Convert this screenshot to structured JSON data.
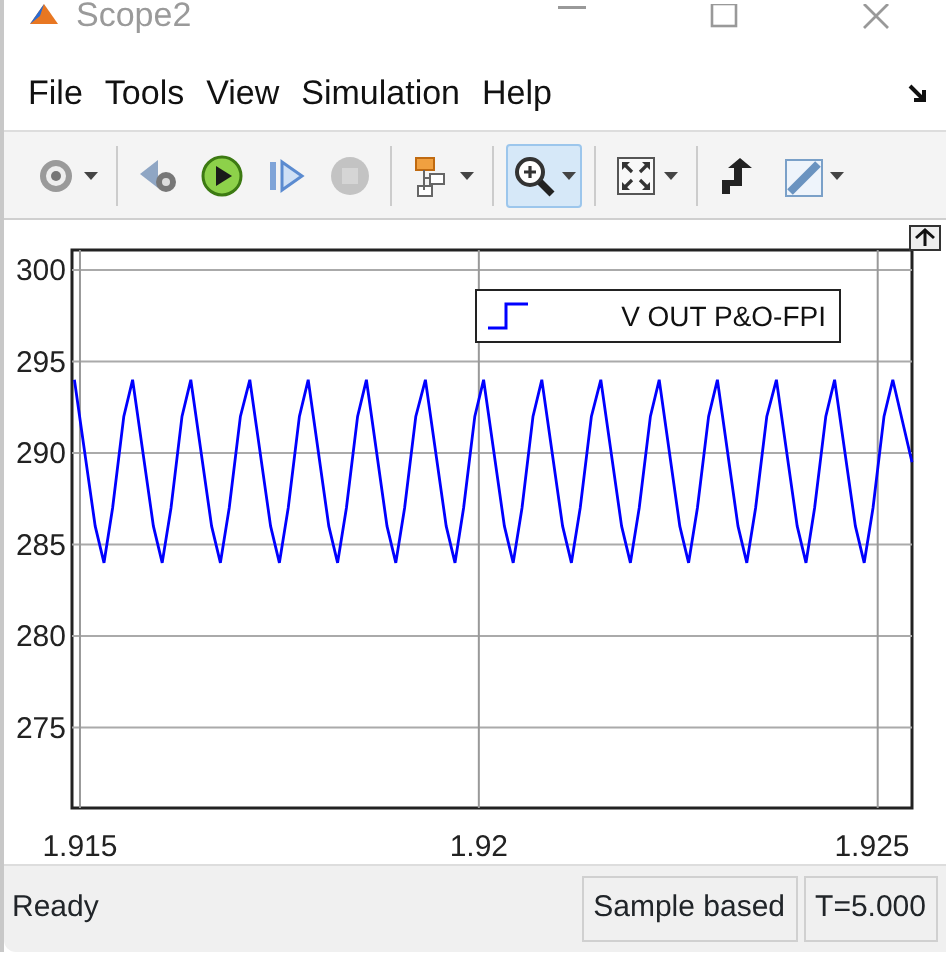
{
  "window": {
    "title": "Scope2"
  },
  "menu": [
    {
      "label": "File"
    },
    {
      "label": "Tools"
    },
    {
      "label": "View"
    },
    {
      "label": "Simulation"
    },
    {
      "label": "Help"
    }
  ],
  "toolbar": [
    [
      {
        "kind": "settings",
        "dropdown": true,
        "selected": false,
        "disabled": false
      }
    ],
    [
      {
        "kind": "step-back",
        "dropdown": false,
        "selected": false,
        "disabled": false
      },
      {
        "kind": "run",
        "dropdown": false,
        "selected": false,
        "disabled": false
      },
      {
        "kind": "step-forward",
        "dropdown": false,
        "selected": false,
        "disabled": false
      },
      {
        "kind": "stop",
        "dropdown": false,
        "selected": false,
        "disabled": true
      }
    ],
    [
      {
        "kind": "signals",
        "dropdown": true,
        "selected": false,
        "disabled": false
      }
    ],
    [
      {
        "kind": "zoom",
        "dropdown": true,
        "selected": true,
        "disabled": false
      }
    ],
    [
      {
        "kind": "fit",
        "dropdown": true,
        "selected": false,
        "disabled": false
      }
    ],
    [
      {
        "kind": "highlight",
        "dropdown": false,
        "selected": false,
        "disabled": false
      },
      {
        "kind": "measure",
        "dropdown": true,
        "selected": false,
        "disabled": false
      }
    ]
  ],
  "plot": {
    "chart_data": {
      "type": "line",
      "grid": true,
      "xlim": [
        1.9149,
        1.92543
      ],
      "ylim": [
        270.6,
        301.1
      ],
      "xticks": [
        1.915,
        1.92,
        1.925
      ],
      "yticks": [
        275,
        280,
        285,
        290,
        295,
        300
      ],
      "x": [
        1.91493,
        1.91519,
        1.9153,
        1.91541,
        1.91555,
        1.91566,
        1.91592,
        1.91603,
        1.91614,
        1.91628,
        1.91639,
        1.91665,
        1.91676,
        1.91687,
        1.91701,
        1.91713,
        1.91739,
        1.9175,
        1.91761,
        1.91775,
        1.91786,
        1.91812,
        1.91823,
        1.91834,
        1.91848,
        1.91859,
        1.91885,
        1.91896,
        1.91907,
        1.91921,
        1.91933,
        1.91959,
        1.9197,
        1.91981,
        1.91995,
        1.92006,
        1.92032,
        1.92043,
        1.92054,
        1.92068,
        1.92079,
        1.92105,
        1.92116,
        1.92127,
        1.92141,
        1.92153,
        1.92179,
        1.9219,
        1.92201,
        1.92215,
        1.92226,
        1.92252,
        1.92263,
        1.92274,
        1.92288,
        1.92299,
        1.92325,
        1.92336,
        1.92347,
        1.92361,
        1.92373,
        1.92399,
        1.9241,
        1.92421,
        1.92435,
        1.92446,
        1.92472,
        1.92483,
        1.92494,
        1.92508,
        1.92519,
        1.92543
      ],
      "series": [
        {
          "name": "V OUT P&O-FPI",
          "color": "#0000ff",
          "values": [
            294,
            286,
            284,
            287,
            292,
            294,
            286,
            284,
            287,
            292,
            294,
            286,
            284,
            287,
            292,
            294,
            286,
            284,
            287,
            292,
            294,
            286,
            284,
            287,
            292,
            294,
            286,
            284,
            287,
            292,
            294,
            286,
            284,
            287,
            292,
            294,
            286,
            284,
            287,
            292,
            294,
            286,
            284,
            287,
            292,
            294,
            286,
            284,
            287,
            292,
            294,
            286,
            284,
            287,
            292,
            294,
            286,
            284,
            287,
            292,
            294,
            286,
            284,
            287,
            292,
            294,
            286,
            284,
            287,
            292,
            294,
            289.5
          ]
        }
      ]
    }
  },
  "status_bar": {
    "message": "Ready",
    "fields": [
      "Sample based",
      "T=5.000"
    ]
  }
}
